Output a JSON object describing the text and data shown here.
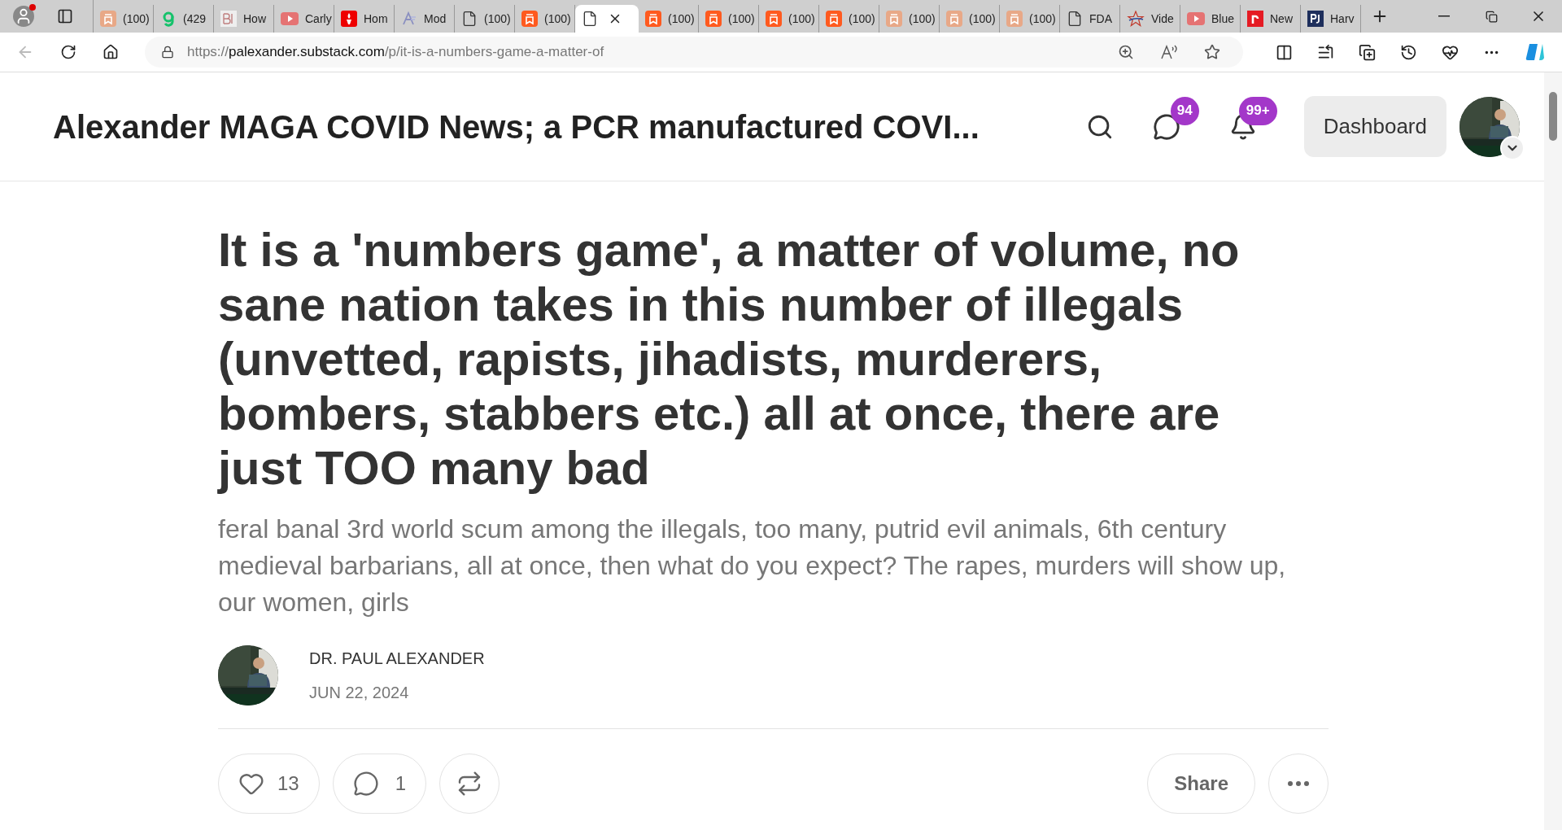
{
  "browser": {
    "tabs": [
      {
        "kind": "substack-faded",
        "title": "(100)",
        "selected": false
      },
      {
        "kind": "g",
        "title": "(429",
        "selected": false
      },
      {
        "kind": "bi",
        "title": "How",
        "selected": false
      },
      {
        "kind": "video",
        "title": "Carly",
        "selected": false
      },
      {
        "kind": "red",
        "title": "Hom",
        "selected": false
      },
      {
        "kind": "ai",
        "title": "Mod",
        "selected": false
      },
      {
        "kind": "doc",
        "title": "(100)",
        "selected": false
      },
      {
        "kind": "substack",
        "title": "(100)",
        "selected": false
      },
      {
        "kind": "doc",
        "selected": true
      },
      {
        "kind": "substack",
        "title": "(100)",
        "selected": false
      },
      {
        "kind": "substack",
        "title": "(100)",
        "selected": false
      },
      {
        "kind": "substack",
        "title": "(100)",
        "selected": false
      },
      {
        "kind": "substack",
        "title": "(100)",
        "selected": false
      },
      {
        "kind": "substack-faded",
        "title": "(100)",
        "selected": false
      },
      {
        "kind": "substack-faded",
        "title": "(100)",
        "selected": false
      },
      {
        "kind": "substack-faded",
        "title": "(100)",
        "selected": false
      },
      {
        "kind": "doc",
        "title": "FDA",
        "selected": false
      },
      {
        "kind": "star",
        "title": "Vide",
        "selected": false
      },
      {
        "kind": "video",
        "title": "Blue",
        "selected": false
      },
      {
        "kind": "r",
        "title": "New",
        "selected": false
      },
      {
        "kind": "pj",
        "title": "Harv",
        "selected": false
      }
    ],
    "url_prefix": "https://",
    "url_host": "palexander.substack.com",
    "url_path": "/p/it-is-a-numbers-game-a-matter-of"
  },
  "header": {
    "publication": "Alexander MAGA COVID News; a PCR manufactured COVI...",
    "messages_badge": "94",
    "notifications_badge": "99+",
    "dashboard": "Dashboard"
  },
  "post": {
    "title": "It is a 'numbers game', a matter of volume, no sane nation takes in this number of illegals (unvetted, rapists, jihadists, murderers, bombers, stabbers etc.) all at once, there are just TOO many bad",
    "subtitle": "feral banal 3rd world scum among the illegals, too many, putrid evil animals, 6th century medieval barbarians, all at once, then what do you expect? The rapes, murders will show up, our women, girls",
    "author": "DR. PAUL ALEXANDER",
    "date": "JUN 22, 2024",
    "likes": "13",
    "comments": "1",
    "share": "Share"
  }
}
